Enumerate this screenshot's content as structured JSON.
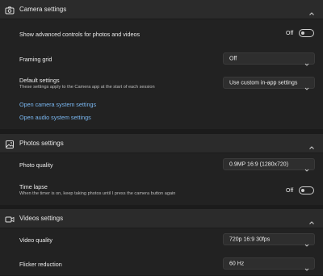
{
  "camera": {
    "header": "Camera settings",
    "advanced_label": "Show advanced controls for photos and videos",
    "advanced_state": "Off",
    "framing_label": "Framing grid",
    "framing_value": "Off",
    "default_label": "Default settings",
    "default_sub": "These settings apply to the Camera app at the start of each session",
    "default_value": "Use custom in-app settings",
    "link_camera": "Open camera system settings",
    "link_audio": "Open audio system settings"
  },
  "photos": {
    "header": "Photos settings",
    "quality_label": "Photo quality",
    "quality_value": "0.9MP 16:9 (1280x720)",
    "timelapse_label": "Time lapse",
    "timelapse_sub": "When the timer is on, keep taking photos until I press the camera button again",
    "timelapse_state": "Off"
  },
  "videos": {
    "header": "Videos settings",
    "quality_label": "Video quality",
    "quality_value": "720p 16:9 30fps",
    "flicker_label": "Flicker reduction",
    "flicker_value": "60 Hz"
  },
  "icons": [
    "camera-icon",
    "photo-icon",
    "video-icon",
    "chevron-up-icon",
    "chevron-down-icon"
  ]
}
